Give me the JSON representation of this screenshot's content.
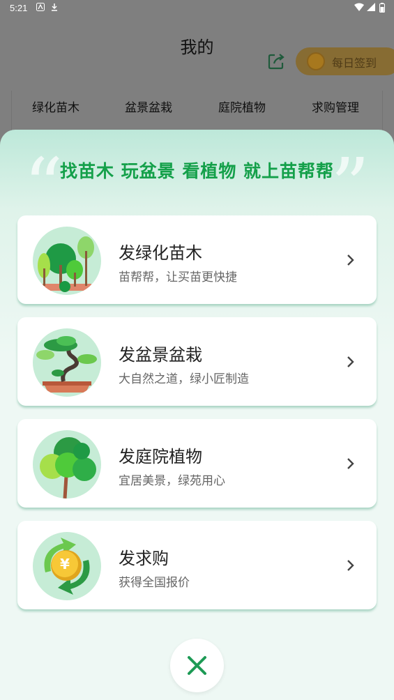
{
  "status_bar": {
    "time": "5:21"
  },
  "header": {
    "title": "我的",
    "checkin_label": "每日签到",
    "tabs": [
      "绿化苗木",
      "盆景盆栽",
      "庭院植物",
      "求购管理"
    ]
  },
  "sheet": {
    "slogan": "找苗木 玩盆景 看植物 就上苗帮帮",
    "cards": [
      {
        "title": "发绿化苗木",
        "subtitle": "苗帮帮，让买苗更快捷",
        "icon": "green-trees-icon"
      },
      {
        "title": "发盆景盆栽",
        "subtitle": "大自然之道，绿小匠制造",
        "icon": "bonsai-icon"
      },
      {
        "title": "发庭院植物",
        "subtitle": "宜居美景，绿苑用心",
        "icon": "courtyard-tree-icon"
      },
      {
        "title": "发求购",
        "subtitle": "获得全国报价",
        "icon": "purchase-coin-icon"
      }
    ]
  },
  "colors": {
    "accent": "#14a04a",
    "overlay": "#7f7f7f",
    "sheet_bg": "#eef8f4"
  }
}
